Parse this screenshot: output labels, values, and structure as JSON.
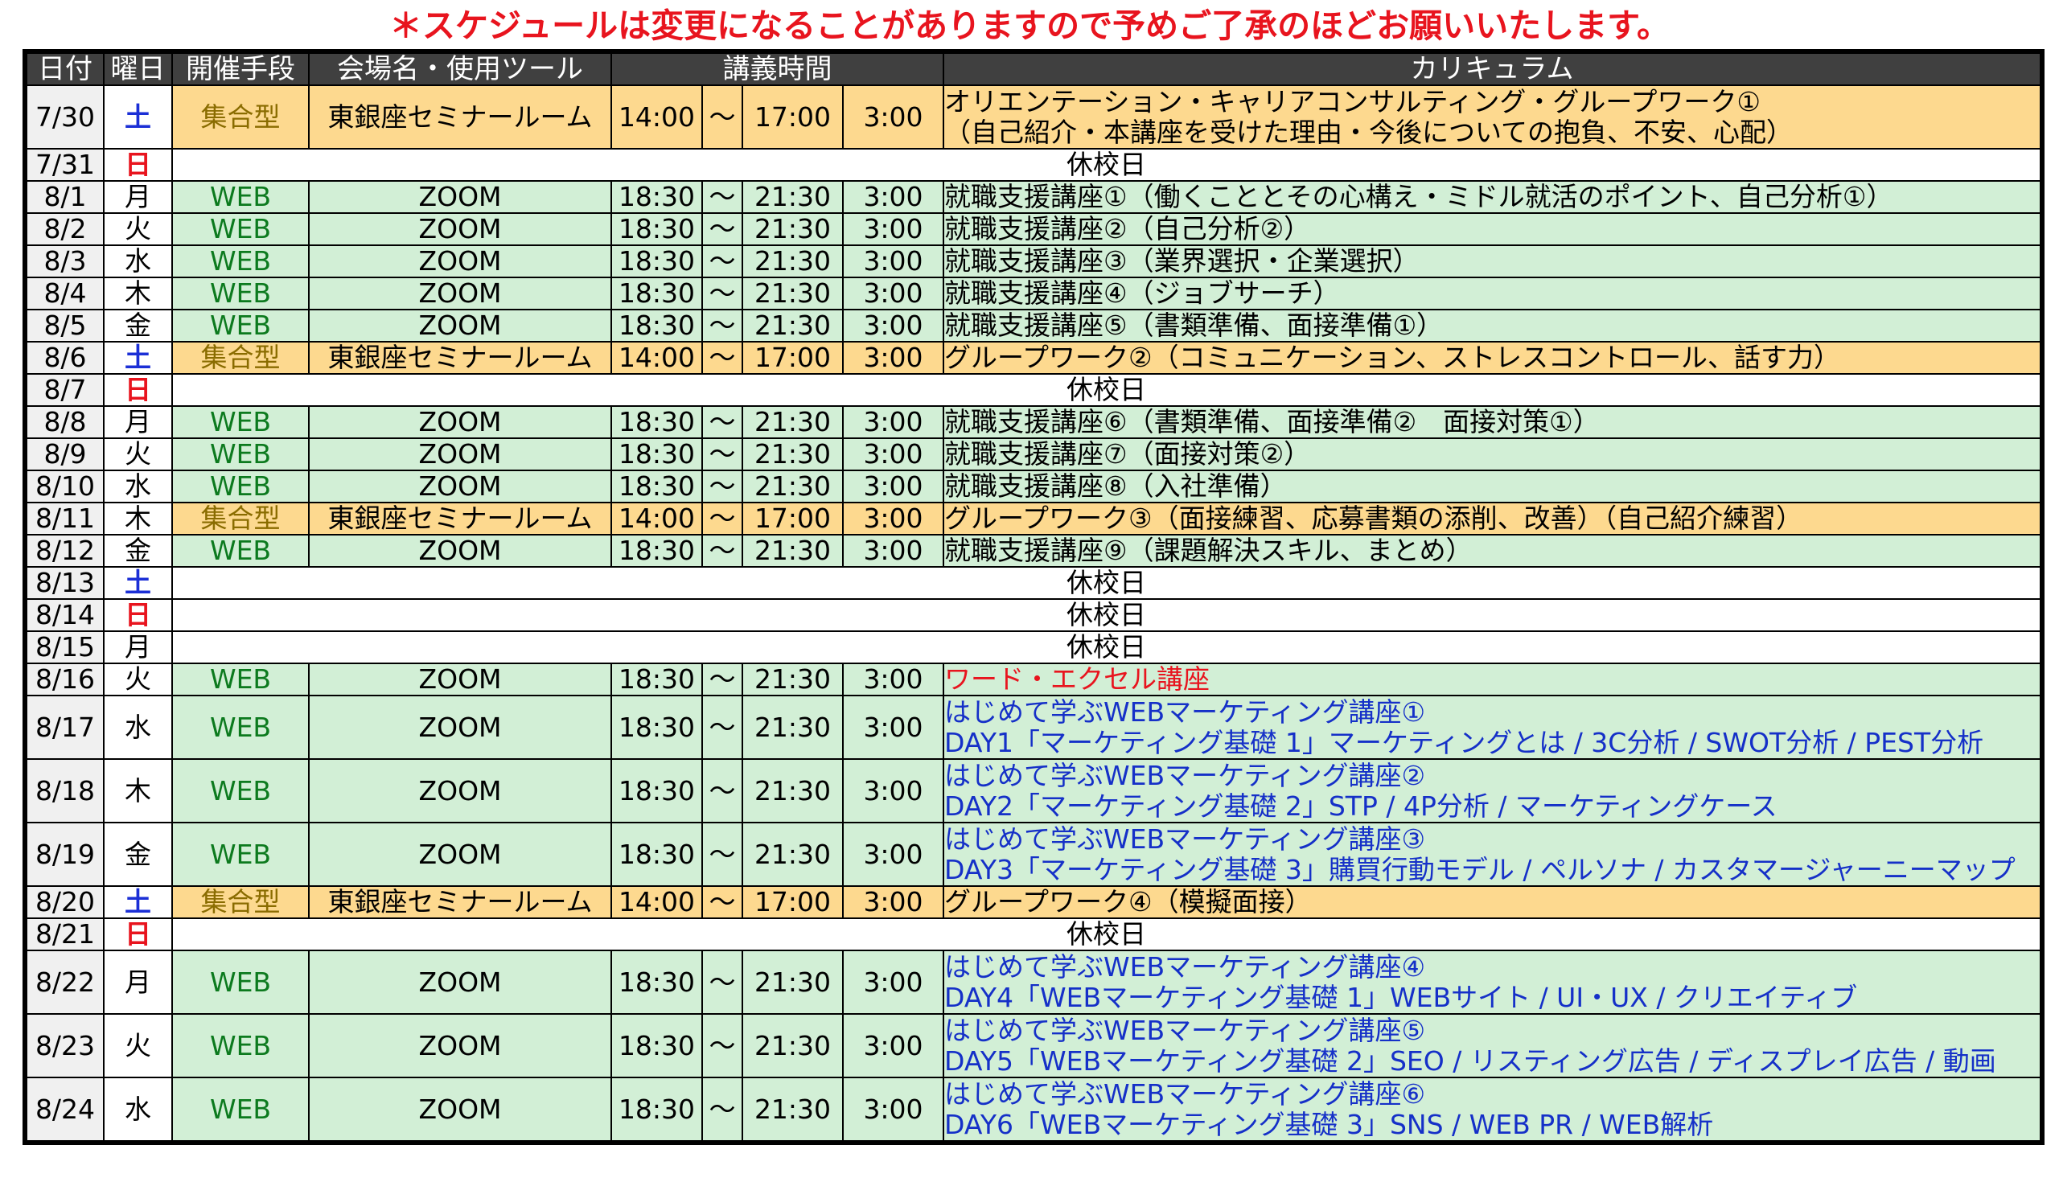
{
  "notice": "＊スケジュールは変更になることがありますので予めご了承のほどお願いいたします。",
  "headers": {
    "date": "日付",
    "dow": "曜日",
    "mode": "開催手段",
    "venue": "会場名・使用ツール",
    "time": "講義時間",
    "curriculum": "カリキュラム"
  },
  "rows": [
    {
      "date": "7/30",
      "dow": "土",
      "mode": "集合型",
      "venue": "東銀座セミナールーム",
      "start": "14:00",
      "sep": "～",
      "end": "17:00",
      "duration": "3:00",
      "line1": "オリエンテーション・キャリアコンサルティング・グループワーク①",
      "line2": "（自己紹介・本講座を受けた理由・今後についての抱負、不安、心配）"
    },
    {
      "date": "7/31",
      "dow": "日",
      "holiday": "休校日"
    },
    {
      "date": "8/1",
      "dow": "月",
      "mode": "WEB",
      "venue": "ZOOM",
      "start": "18:30",
      "sep": "～",
      "end": "21:30",
      "duration": "3:00",
      "line1": "就職支援講座①（働くこととその心構え・ミドル就活のポイント、自己分析①）"
    },
    {
      "date": "8/2",
      "dow": "火",
      "mode": "WEB",
      "venue": "ZOOM",
      "start": "18:30",
      "sep": "～",
      "end": "21:30",
      "duration": "3:00",
      "line1": "就職支援講座②（自己分析②）"
    },
    {
      "date": "8/3",
      "dow": "水",
      "mode": "WEB",
      "venue": "ZOOM",
      "start": "18:30",
      "sep": "～",
      "end": "21:30",
      "duration": "3:00",
      "line1": "就職支援講座③（業界選択・企業選択）"
    },
    {
      "date": "8/4",
      "dow": "木",
      "mode": "WEB",
      "venue": "ZOOM",
      "start": "18:30",
      "sep": "～",
      "end": "21:30",
      "duration": "3:00",
      "line1": "就職支援講座④（ジョブサーチ）"
    },
    {
      "date": "8/5",
      "dow": "金",
      "mode": "WEB",
      "venue": "ZOOM",
      "start": "18:30",
      "sep": "～",
      "end": "21:30",
      "duration": "3:00",
      "line1": "就職支援講座⑤（書類準備、面接準備①）"
    },
    {
      "date": "8/6",
      "dow": "土",
      "mode": "集合型",
      "venue": "東銀座セミナールーム",
      "start": "14:00",
      "sep": "～",
      "end": "17:00",
      "duration": "3:00",
      "line1": "グループワーク②（コミュニケーション、ストレスコントロール、話す力）"
    },
    {
      "date": "8/7",
      "dow": "日",
      "holiday": "休校日"
    },
    {
      "date": "8/8",
      "dow": "月",
      "mode": "WEB",
      "venue": "ZOOM",
      "start": "18:30",
      "sep": "～",
      "end": "21:30",
      "duration": "3:00",
      "line1": "就職支援講座⑥（書類準備、面接準備②　面接対策①）"
    },
    {
      "date": "8/9",
      "dow": "火",
      "mode": "WEB",
      "venue": "ZOOM",
      "start": "18:30",
      "sep": "～",
      "end": "21:30",
      "duration": "3:00",
      "line1": "就職支援講座⑦（面接対策②）"
    },
    {
      "date": "8/10",
      "dow": "水",
      "mode": "WEB",
      "venue": "ZOOM",
      "start": "18:30",
      "sep": "～",
      "end": "21:30",
      "duration": "3:00",
      "line1": "就職支援講座⑧（入社準備）"
    },
    {
      "date": "8/11",
      "dow": "木",
      "mode": "集合型",
      "venue": "東銀座セミナールーム",
      "start": "14:00",
      "sep": "～",
      "end": "17:00",
      "duration": "3:00",
      "line1": "グループワーク③（面接練習、応募書類の添削、改善）（自己紹介練習）"
    },
    {
      "date": "8/12",
      "dow": "金",
      "mode": "WEB",
      "venue": "ZOOM",
      "start": "18:30",
      "sep": "～",
      "end": "21:30",
      "duration": "3:00",
      "line1": "就職支援講座⑨（課題解決スキル、まとめ）"
    },
    {
      "date": "8/13",
      "dow": "土",
      "holiday": "休校日"
    },
    {
      "date": "8/14",
      "dow": "日",
      "holiday": "休校日"
    },
    {
      "date": "8/15",
      "dow": "月",
      "holiday": "休校日"
    },
    {
      "date": "8/16",
      "dow": "火",
      "mode": "WEB",
      "venue": "ZOOM",
      "start": "18:30",
      "sep": "～",
      "end": "21:30",
      "duration": "3:00",
      "line1": "ワード・エクセル講座"
    },
    {
      "date": "8/17",
      "dow": "水",
      "mode": "WEB",
      "venue": "ZOOM",
      "start": "18:30",
      "sep": "～",
      "end": "21:30",
      "duration": "3:00",
      "line1": "はじめて学ぶWEBマーケティング講座①",
      "line2": "DAY1「マーケティング基礎 1」マーケティングとは / 3C分析 / SWOT分析 / PEST分析"
    },
    {
      "date": "8/18",
      "dow": "木",
      "mode": "WEB",
      "venue": "ZOOM",
      "start": "18:30",
      "sep": "～",
      "end": "21:30",
      "duration": "3:00",
      "line1": "はじめて学ぶWEBマーケティング講座②",
      "line2": "DAY2「マーケティング基礎 2」STP / 4P分析 / マーケティングケース"
    },
    {
      "date": "8/19",
      "dow": "金",
      "mode": "WEB",
      "venue": "ZOOM",
      "start": "18:30",
      "sep": "～",
      "end": "21:30",
      "duration": "3:00",
      "line1": "はじめて学ぶWEBマーケティング講座③",
      "line2": "DAY3「マーケティング基礎 3」購買行動モデル / ペルソナ / カスタマージャーニーマップ"
    },
    {
      "date": "8/20",
      "dow": "土",
      "mode": "集合型",
      "venue": "東銀座セミナールーム",
      "start": "14:00",
      "sep": "～",
      "end": "17:00",
      "duration": "3:00",
      "line1": "グループワーク④（模擬面接）"
    },
    {
      "date": "8/21",
      "dow": "日",
      "holiday": "休校日"
    },
    {
      "date": "8/22",
      "dow": "月",
      "mode": "WEB",
      "venue": "ZOOM",
      "start": "18:30",
      "sep": "～",
      "end": "21:30",
      "duration": "3:00",
      "line1": "はじめて学ぶWEBマーケティング講座④",
      "line2": "DAY4「WEBマーケティング基礎 1」WEBサイト / UI・UX / クリエイティブ"
    },
    {
      "date": "8/23",
      "dow": "火",
      "mode": "WEB",
      "venue": "ZOOM",
      "start": "18:30",
      "sep": "～",
      "end": "21:30",
      "duration": "3:00",
      "line1": "はじめて学ぶWEBマーケティング講座⑤",
      "line2": "DAY5「WEBマーケティング基礎 2」SEO / リスティング広告 / ディスプレイ広告 / 動画"
    },
    {
      "date": "8/24",
      "dow": "水",
      "mode": "WEB",
      "venue": "ZOOM",
      "start": "18:30",
      "sep": "～",
      "end": "21:30",
      "duration": "3:00",
      "line1": "はじめて学ぶWEBマーケティング講座⑥",
      "line2": "DAY6「WEBマーケティング基礎 3」SNS / WEB PR / WEB解析"
    }
  ]
}
